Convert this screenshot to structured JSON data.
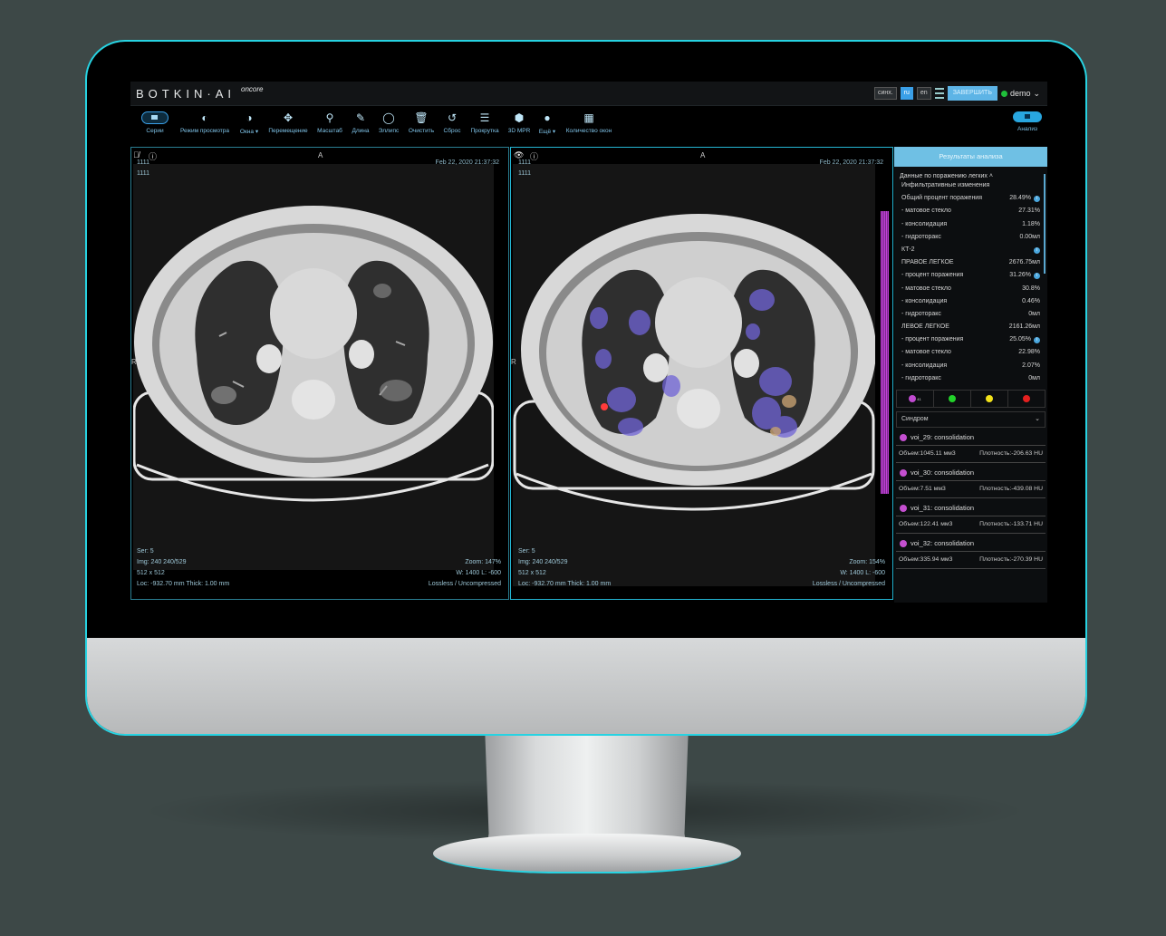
{
  "app": {
    "brand": "BOTKIN·AI",
    "brand_sup": "oncore",
    "sync_label": "синх.",
    "lang_ru": "ru",
    "lang_en": "en",
    "finish_label": "ЗАВЕРШИТЬ",
    "user_name": "demo"
  },
  "toolbar": {
    "series": "Серии",
    "view_mode": "Режим просмотра",
    "windows": "Окна ▾",
    "move": "Перемещение",
    "zoom": "Масштаб",
    "length": "Длина",
    "ellipse": "Эллипс",
    "clear": "Очистить",
    "reset": "Сброс",
    "scroll": "Прокрутка",
    "mpr": "3D MPR",
    "more": "Ещё ▾",
    "window_count": "Количество окон",
    "analysis": "Анализ"
  },
  "viewports": [
    {
      "orientation_top": "A",
      "orientation_left": "R",
      "id1": "1111",
      "id2": "1111",
      "date": "Feb 22, 2020 21:37:32",
      "ser": "Ser: 5",
      "img": "Img: 240 240/529",
      "matrix": "512 x 512",
      "loc": "Loc: -932.70 mm Thick: 1.00 mm",
      "zoom": "Zoom: 147%",
      "window": "W: 1400 L: -600",
      "compression": "Lossless / Uncompressed"
    },
    {
      "orientation_top": "A",
      "orientation_left": "R",
      "id1": "1111",
      "id2": "1111",
      "date": "Feb 22, 2020 21:37:32",
      "ser": "Ser: 5",
      "img": "Img: 240 240/529",
      "matrix": "512 x 512",
      "loc": "Loc: -932.70 mm Thick: 1.00 mm",
      "zoom": "Zoom: 154%",
      "window": "W: 1400 L: -600",
      "compression": "Lossless / Uncompressed"
    }
  ],
  "results": {
    "title": "Результаты анализа",
    "section": "Данные по поражению легких ˄",
    "rows": [
      {
        "label": "Инфильтративные изменения",
        "value": "",
        "info": false
      },
      {
        "label": "Общий процент поражения",
        "value": "28.49%",
        "info": true
      },
      {
        "label": "- матовое стекло",
        "value": "27.31%",
        "info": false
      },
      {
        "label": "- консолидация",
        "value": "1.18%",
        "info": false
      },
      {
        "label": "- гидроторакс",
        "value": "0.00мл",
        "info": false
      },
      {
        "label": "КТ-2",
        "value": "",
        "info": true
      },
      {
        "label": "ПРАВОЕ ЛЕГКОЕ",
        "value": "2676.75мл",
        "info": false
      },
      {
        "label": "- процент поражения",
        "value": "31.26%",
        "info": true
      },
      {
        "label": "- матовое стекло",
        "value": "30.8%",
        "info": false
      },
      {
        "label": "- консолидация",
        "value": "0.46%",
        "info": false
      },
      {
        "label": "- гидроторакс",
        "value": "0мл",
        "info": false
      },
      {
        "label": "ЛЕВОЕ ЛЕГКОЕ",
        "value": "2161.26мл",
        "info": false
      },
      {
        "label": "- процент поражения",
        "value": "25.05%",
        "info": true
      },
      {
        "label": "- матовое стекло",
        "value": "22.98%",
        "info": false
      },
      {
        "label": "- консолидация",
        "value": "2.07%",
        "info": false
      },
      {
        "label": "- гидроторакс",
        "value": "0мл",
        "info": false
      }
    ],
    "swatches": [
      {
        "color": "#c04ad0",
        "badge": "41"
      },
      {
        "color": "#22d22a",
        "badge": ""
      },
      {
        "color": "#f2e21a",
        "badge": ""
      },
      {
        "color": "#e5201f",
        "badge": ""
      }
    ],
    "filter_label": "Синдром",
    "vois": [
      {
        "name": "voi_29: consolidation",
        "volume": "Объем:1045.11 мм3",
        "density": "Плотность:-206.63 HU"
      },
      {
        "name": "voi_30: consolidation",
        "volume": "Объем:7.51 мм3",
        "density": "Плотность:-439.08 HU"
      },
      {
        "name": "voi_31: consolidation",
        "volume": "Объем:122.41 мм3",
        "density": "Плотность:-133.71 HU"
      },
      {
        "name": "voi_32: consolidation",
        "volume": "Объем:335.94 мм3",
        "density": "Плотность:-270.39 HU"
      }
    ]
  },
  "colors": {
    "accent": "#27d3e2",
    "panel_header": "#6fc0e4",
    "lesion": "#7a6ee0",
    "voi": "#c44fd0"
  }
}
